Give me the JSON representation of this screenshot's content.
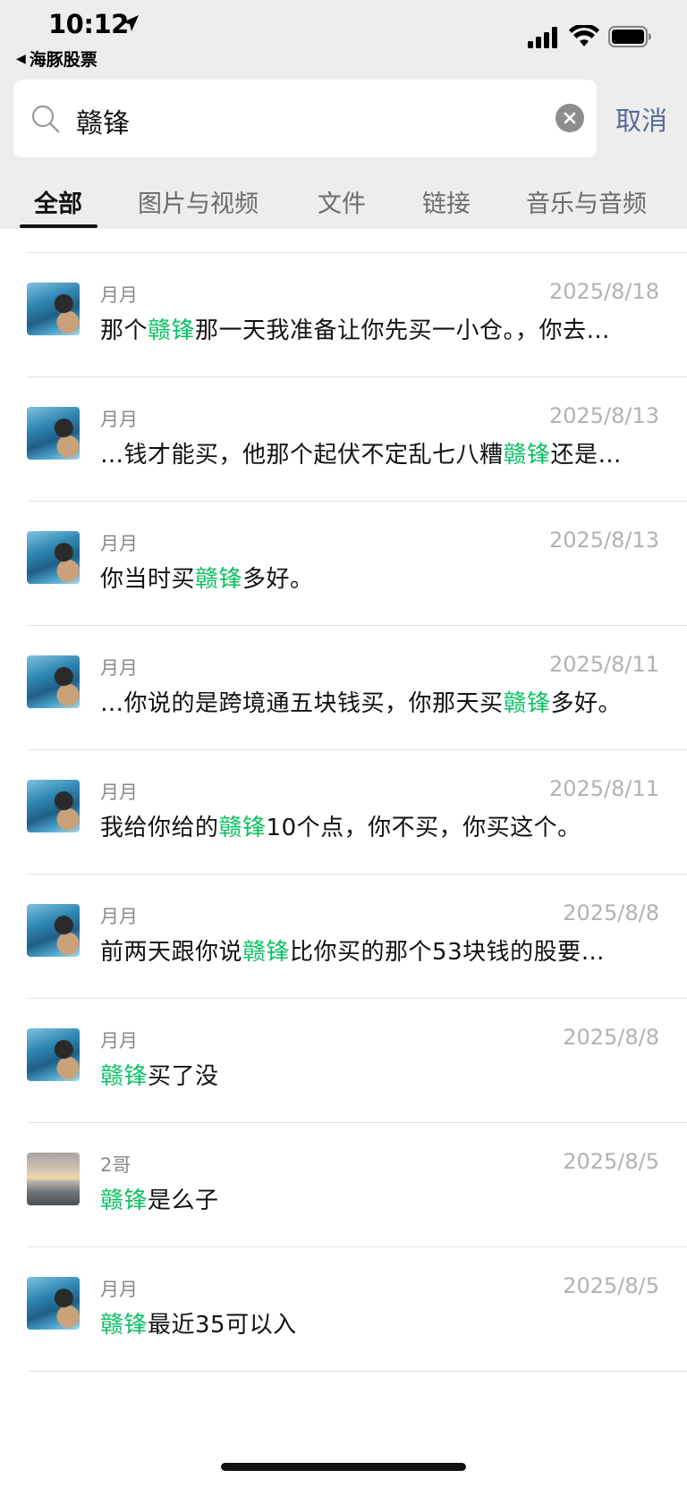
{
  "status_bar": {
    "time": "10:12",
    "back_app": "海豚股票",
    "icons": [
      "location-arrow-icon",
      "signal-icon",
      "wifi-icon",
      "battery-icon"
    ]
  },
  "search": {
    "query": "赣锋",
    "cancel_label": "取消",
    "icons": [
      "search-icon",
      "clear-icon"
    ]
  },
  "tabs": [
    {
      "label": "全部",
      "active": true
    },
    {
      "label": "图片与视频",
      "active": false
    },
    {
      "label": "文件",
      "active": false
    },
    {
      "label": "链接",
      "active": false
    },
    {
      "label": "音乐与音频",
      "active": false
    }
  ],
  "colors": {
    "highlight": "#07c160",
    "cancel": "#576b95",
    "header_bg": "#ededed"
  },
  "results": [
    {
      "sender": "月月",
      "date": "2025/8/18",
      "avatar": "sea",
      "pre": "那个",
      "keyword": "赣锋",
      "post": "那一天我准备让你先买一小仓。，你去…"
    },
    {
      "sender": "月月",
      "date": "2025/8/13",
      "avatar": "sea",
      "pre": "…钱才能买，他那个起伏不定乱七八糟",
      "keyword": "赣锋",
      "post": "还是…"
    },
    {
      "sender": "月月",
      "date": "2025/8/13",
      "avatar": "sea",
      "pre": "你当时买",
      "keyword": "赣锋",
      "post": "多好。"
    },
    {
      "sender": "月月",
      "date": "2025/8/11",
      "avatar": "sea",
      "pre": "…你说的是跨境通五块钱买，你那天买",
      "keyword": "赣锋",
      "post": "多好。"
    },
    {
      "sender": "月月",
      "date": "2025/8/11",
      "avatar": "sea",
      "pre": "我给你给的",
      "keyword": "赣锋",
      "post": "10个点，你不买，你买这个。"
    },
    {
      "sender": "月月",
      "date": "2025/8/8",
      "avatar": "sea",
      "pre": "前两天跟你说",
      "keyword": "赣锋",
      "post": "比你买的那个53块钱的股要…"
    },
    {
      "sender": "月月",
      "date": "2025/8/8",
      "avatar": "sea",
      "pre": "",
      "keyword": "赣锋",
      "post": "买了没"
    },
    {
      "sender": "2哥",
      "date": "2025/8/5",
      "avatar": "sunset",
      "pre": "",
      "keyword": "赣锋",
      "post": "是么子"
    },
    {
      "sender": "月月",
      "date": "2025/8/5",
      "avatar": "sea",
      "pre": "",
      "keyword": "赣锋",
      "post": "最近35可以入"
    }
  ]
}
